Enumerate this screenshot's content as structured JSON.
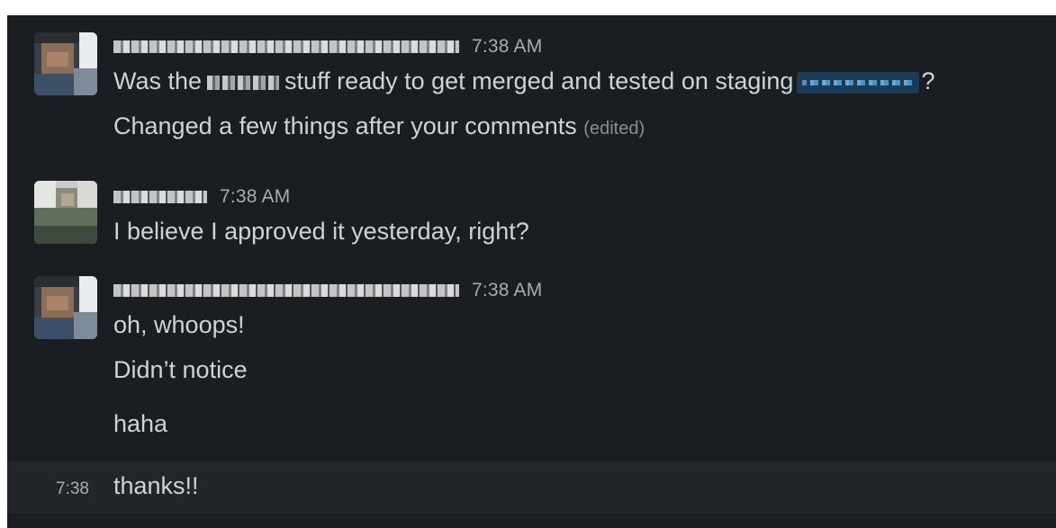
{
  "messages": [
    {
      "timestamp": "7:38 AM",
      "lines": [
        {
          "before": "Was the",
          "middle": "stuff ready to get merged and tested on staging",
          "after": "?"
        },
        {
          "text": "Changed a few things after your comments",
          "edited": "(edited)"
        }
      ]
    },
    {
      "timestamp": "7:38 AM",
      "lines": [
        {
          "text": "I believe I approved it yesterday, right?"
        }
      ]
    },
    {
      "timestamp": "7:38 AM",
      "lines": [
        {
          "text": "oh, whoops!"
        },
        {
          "text": "Didn’t notice"
        },
        {
          "text": "haha"
        }
      ]
    }
  ],
  "hover_message": {
    "time": "7:38",
    "text": "thanks!!"
  },
  "colors": {
    "background": "#1a1d21",
    "hover_background": "#222529",
    "text": "#d1d2d3",
    "muted": "#ababad",
    "mention": "#4a9ed8"
  }
}
